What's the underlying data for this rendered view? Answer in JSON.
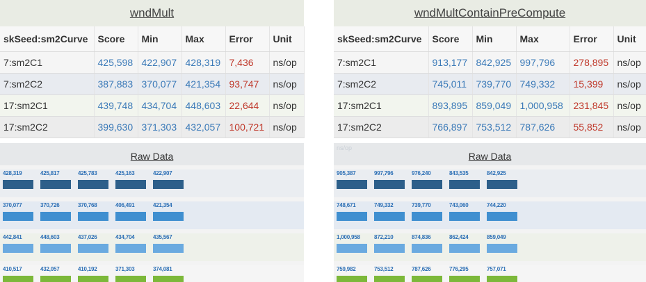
{
  "panels": [
    {
      "title": "wndMult",
      "columns": [
        "skSeed:sm2Curve",
        "Score",
        "Min",
        "Max",
        "Error",
        "Unit"
      ],
      "rows": [
        {
          "name": "7:sm2C1",
          "score": "425,598",
          "min": "422,907",
          "max": "428,319",
          "error": "7,436",
          "unit": "ns/op"
        },
        {
          "name": "7:sm2C2",
          "score": "387,883",
          "min": "370,077",
          "max": "421,354",
          "error": "93,747",
          "unit": "ns/op"
        },
        {
          "name": "17:sm2C1",
          "score": "439,748",
          "min": "434,704",
          "max": "448,603",
          "error": "22,644",
          "unit": "ns/op"
        },
        {
          "name": "17:sm2C2",
          "score": "399,630",
          "min": "371,303",
          "max": "432,057",
          "error": "100,721",
          "unit": "ns/op"
        }
      ],
      "raw_title": "Raw Data",
      "raw_faint_label": "",
      "raw_rows": [
        [
          "428,319",
          "425,817",
          "425,783",
          "425,163",
          "422,907"
        ],
        [
          "370,077",
          "370,726",
          "370,768",
          "406,491",
          "421,354"
        ],
        [
          "442,841",
          "448,603",
          "437,026",
          "434,704",
          "435,567"
        ],
        [
          "410,517",
          "432,057",
          "410,192",
          "371,303",
          "374,081"
        ]
      ]
    },
    {
      "title": "wndMultContainPreCompute",
      "columns": [
        "skSeed:sm2Curve",
        "Score",
        "Min",
        "Max",
        "Error",
        "Unit"
      ],
      "rows": [
        {
          "name": "7:sm2C1",
          "score": "913,177",
          "min": "842,925",
          "max": "997,796",
          "error": "278,895",
          "unit": "ns/op"
        },
        {
          "name": "7:sm2C2",
          "score": "745,011",
          "min": "739,770",
          "max": "749,332",
          "error": "15,399",
          "unit": "ns/op"
        },
        {
          "name": "17:sm2C1",
          "score": "893,895",
          "min": "859,049",
          "max": "1,000,958",
          "error": "231,845",
          "unit": "ns/op"
        },
        {
          "name": "17:sm2C2",
          "score": "766,897",
          "min": "753,512",
          "max": "787,626",
          "error": "55,852",
          "unit": "ns/op"
        }
      ],
      "raw_title": "Raw Data",
      "raw_faint_label": "ns/op",
      "raw_rows": [
        [
          "905,387",
          "997,796",
          "976,240",
          "843,535",
          "842,925"
        ],
        [
          "748,671",
          "749,332",
          "739,770",
          "743,060",
          "744,220"
        ],
        [
          "1,000,958",
          "872,210",
          "874,836",
          "862,424",
          "859,049"
        ],
        [
          "759,982",
          "753,512",
          "787,626",
          "776,295",
          "757,071"
        ]
      ]
    }
  ],
  "colors": {
    "bar_row_colors": [
      "#2d5f8a",
      "#3f8fd0",
      "#6aaae0",
      "#7cb83a"
    ],
    "band_colors": [
      "#eaedf1",
      "#e4eaf2",
      "#eef1ea",
      "#f5f5f5"
    ],
    "number_blue": "#3b7ab8",
    "error_red": "#c0392b"
  }
}
